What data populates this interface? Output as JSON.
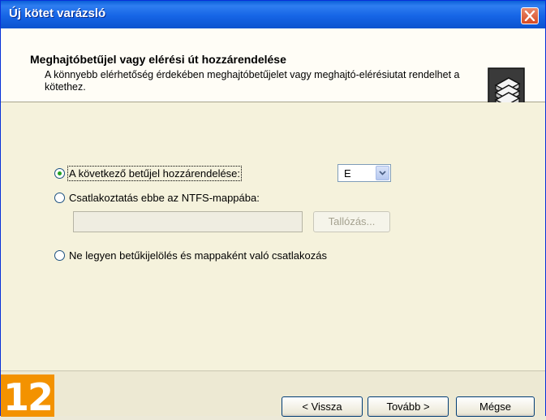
{
  "window": {
    "title": "Új kötet varázsló"
  },
  "header": {
    "title": "Meghajtóbetűjel vagy elérési út hozzárendelése",
    "subtitle": "A könnyebb elérhetőség érdekében meghajtóbetűjelet vagy meghajtó-elérésiutat rendelhet a kötethez."
  },
  "options": {
    "assign_letter": {
      "label": "A következő betűjel hozzárendelése:",
      "checked": true
    },
    "drive_letter": {
      "value": "E"
    },
    "mount_folder": {
      "label": "Csatlakoztatás ebbe az NTFS-mappába:",
      "checked": false,
      "path_value": ""
    },
    "browse_label": "Tallózás...",
    "no_letter": {
      "label": "Ne legyen betűkijelölés és mappaként való csatlakozás",
      "checked": false
    }
  },
  "footer": {
    "step_badge": "12",
    "back_label": "< Vissza",
    "next_label": "Tovább >",
    "cancel_label": "Mégse"
  },
  "colors": {
    "titlebar": "#1665e6",
    "badge": "#f39200",
    "radio_dot": "#21a121"
  }
}
